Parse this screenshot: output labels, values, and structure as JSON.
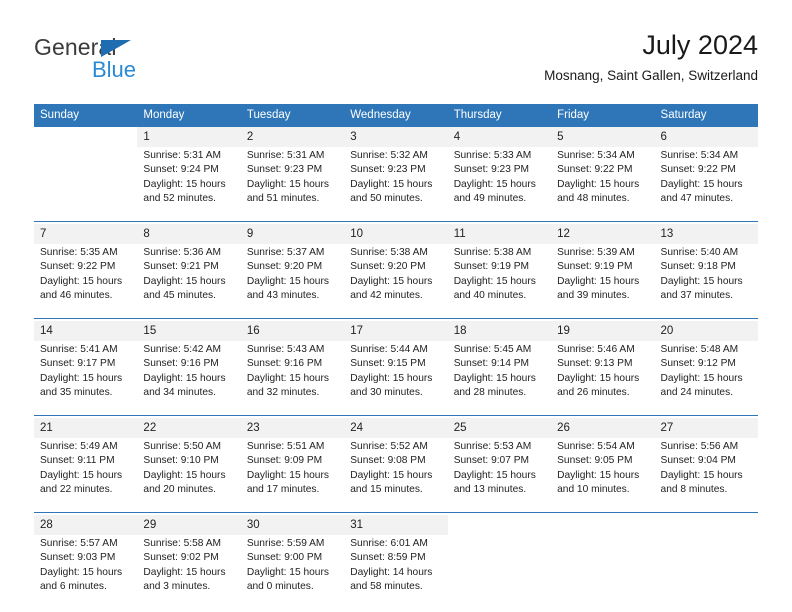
{
  "brand": {
    "name_top": "General",
    "name_bottom": "Blue",
    "triangle_color": "#1f6cb0",
    "blue_color": "#2a8ad4"
  },
  "header": {
    "title": "July 2024",
    "subtitle": "Mosnang, Saint Gallen, Switzerland"
  },
  "theme": {
    "header_blue": "#2e76b8",
    "date_band_gray": "#f2f2f2",
    "text_color": "#222222"
  },
  "calendar": {
    "weekday_headers": [
      "Sunday",
      "Monday",
      "Tuesday",
      "Wednesday",
      "Thursday",
      "Friday",
      "Saturday"
    ],
    "weeks": [
      {
        "dates": [
          "",
          "1",
          "2",
          "3",
          "4",
          "5",
          "6"
        ],
        "cells": [
          {
            "sunrise": "",
            "sunset": "",
            "daylight1": "",
            "daylight2": ""
          },
          {
            "sunrise": "Sunrise: 5:31 AM",
            "sunset": "Sunset: 9:24 PM",
            "daylight1": "Daylight: 15 hours",
            "daylight2": "and 52 minutes."
          },
          {
            "sunrise": "Sunrise: 5:31 AM",
            "sunset": "Sunset: 9:23 PM",
            "daylight1": "Daylight: 15 hours",
            "daylight2": "and 51 minutes."
          },
          {
            "sunrise": "Sunrise: 5:32 AM",
            "sunset": "Sunset: 9:23 PM",
            "daylight1": "Daylight: 15 hours",
            "daylight2": "and 50 minutes."
          },
          {
            "sunrise": "Sunrise: 5:33 AM",
            "sunset": "Sunset: 9:23 PM",
            "daylight1": "Daylight: 15 hours",
            "daylight2": "and 49 minutes."
          },
          {
            "sunrise": "Sunrise: 5:34 AM",
            "sunset": "Sunset: 9:22 PM",
            "daylight1": "Daylight: 15 hours",
            "daylight2": "and 48 minutes."
          },
          {
            "sunrise": "Sunrise: 5:34 AM",
            "sunset": "Sunset: 9:22 PM",
            "daylight1": "Daylight: 15 hours",
            "daylight2": "and 47 minutes."
          }
        ]
      },
      {
        "dates": [
          "7",
          "8",
          "9",
          "10",
          "11",
          "12",
          "13"
        ],
        "cells": [
          {
            "sunrise": "Sunrise: 5:35 AM",
            "sunset": "Sunset: 9:22 PM",
            "daylight1": "Daylight: 15 hours",
            "daylight2": "and 46 minutes."
          },
          {
            "sunrise": "Sunrise: 5:36 AM",
            "sunset": "Sunset: 9:21 PM",
            "daylight1": "Daylight: 15 hours",
            "daylight2": "and 45 minutes."
          },
          {
            "sunrise": "Sunrise: 5:37 AM",
            "sunset": "Sunset: 9:20 PM",
            "daylight1": "Daylight: 15 hours",
            "daylight2": "and 43 minutes."
          },
          {
            "sunrise": "Sunrise: 5:38 AM",
            "sunset": "Sunset: 9:20 PM",
            "daylight1": "Daylight: 15 hours",
            "daylight2": "and 42 minutes."
          },
          {
            "sunrise": "Sunrise: 5:38 AM",
            "sunset": "Sunset: 9:19 PM",
            "daylight1": "Daylight: 15 hours",
            "daylight2": "and 40 minutes."
          },
          {
            "sunrise": "Sunrise: 5:39 AM",
            "sunset": "Sunset: 9:19 PM",
            "daylight1": "Daylight: 15 hours",
            "daylight2": "and 39 minutes."
          },
          {
            "sunrise": "Sunrise: 5:40 AM",
            "sunset": "Sunset: 9:18 PM",
            "daylight1": "Daylight: 15 hours",
            "daylight2": "and 37 minutes."
          }
        ]
      },
      {
        "dates": [
          "14",
          "15",
          "16",
          "17",
          "18",
          "19",
          "20"
        ],
        "cells": [
          {
            "sunrise": "Sunrise: 5:41 AM",
            "sunset": "Sunset: 9:17 PM",
            "daylight1": "Daylight: 15 hours",
            "daylight2": "and 35 minutes."
          },
          {
            "sunrise": "Sunrise: 5:42 AM",
            "sunset": "Sunset: 9:16 PM",
            "daylight1": "Daylight: 15 hours",
            "daylight2": "and 34 minutes."
          },
          {
            "sunrise": "Sunrise: 5:43 AM",
            "sunset": "Sunset: 9:16 PM",
            "daylight1": "Daylight: 15 hours",
            "daylight2": "and 32 minutes."
          },
          {
            "sunrise": "Sunrise: 5:44 AM",
            "sunset": "Sunset: 9:15 PM",
            "daylight1": "Daylight: 15 hours",
            "daylight2": "and 30 minutes."
          },
          {
            "sunrise": "Sunrise: 5:45 AM",
            "sunset": "Sunset: 9:14 PM",
            "daylight1": "Daylight: 15 hours",
            "daylight2": "and 28 minutes."
          },
          {
            "sunrise": "Sunrise: 5:46 AM",
            "sunset": "Sunset: 9:13 PM",
            "daylight1": "Daylight: 15 hours",
            "daylight2": "and 26 minutes."
          },
          {
            "sunrise": "Sunrise: 5:48 AM",
            "sunset": "Sunset: 9:12 PM",
            "daylight1": "Daylight: 15 hours",
            "daylight2": "and 24 minutes."
          }
        ]
      },
      {
        "dates": [
          "21",
          "22",
          "23",
          "24",
          "25",
          "26",
          "27"
        ],
        "cells": [
          {
            "sunrise": "Sunrise: 5:49 AM",
            "sunset": "Sunset: 9:11 PM",
            "daylight1": "Daylight: 15 hours",
            "daylight2": "and 22 minutes."
          },
          {
            "sunrise": "Sunrise: 5:50 AM",
            "sunset": "Sunset: 9:10 PM",
            "daylight1": "Daylight: 15 hours",
            "daylight2": "and 20 minutes."
          },
          {
            "sunrise": "Sunrise: 5:51 AM",
            "sunset": "Sunset: 9:09 PM",
            "daylight1": "Daylight: 15 hours",
            "daylight2": "and 17 minutes."
          },
          {
            "sunrise": "Sunrise: 5:52 AM",
            "sunset": "Sunset: 9:08 PM",
            "daylight1": "Daylight: 15 hours",
            "daylight2": "and 15 minutes."
          },
          {
            "sunrise": "Sunrise: 5:53 AM",
            "sunset": "Sunset: 9:07 PM",
            "daylight1": "Daylight: 15 hours",
            "daylight2": "and 13 minutes."
          },
          {
            "sunrise": "Sunrise: 5:54 AM",
            "sunset": "Sunset: 9:05 PM",
            "daylight1": "Daylight: 15 hours",
            "daylight2": "and 10 minutes."
          },
          {
            "sunrise": "Sunrise: 5:56 AM",
            "sunset": "Sunset: 9:04 PM",
            "daylight1": "Daylight: 15 hours",
            "daylight2": "and 8 minutes."
          }
        ]
      },
      {
        "dates": [
          "28",
          "29",
          "30",
          "31",
          "",
          "",
          ""
        ],
        "cells": [
          {
            "sunrise": "Sunrise: 5:57 AM",
            "sunset": "Sunset: 9:03 PM",
            "daylight1": "Daylight: 15 hours",
            "daylight2": "and 6 minutes."
          },
          {
            "sunrise": "Sunrise: 5:58 AM",
            "sunset": "Sunset: 9:02 PM",
            "daylight1": "Daylight: 15 hours",
            "daylight2": "and 3 minutes."
          },
          {
            "sunrise": "Sunrise: 5:59 AM",
            "sunset": "Sunset: 9:00 PM",
            "daylight1": "Daylight: 15 hours",
            "daylight2": "and 0 minutes."
          },
          {
            "sunrise": "Sunrise: 6:01 AM",
            "sunset": "Sunset: 8:59 PM",
            "daylight1": "Daylight: 14 hours",
            "daylight2": "and 58 minutes."
          },
          {
            "sunrise": "",
            "sunset": "",
            "daylight1": "",
            "daylight2": ""
          },
          {
            "sunrise": "",
            "sunset": "",
            "daylight1": "",
            "daylight2": ""
          },
          {
            "sunrise": "",
            "sunset": "",
            "daylight1": "",
            "daylight2": ""
          }
        ]
      }
    ]
  }
}
